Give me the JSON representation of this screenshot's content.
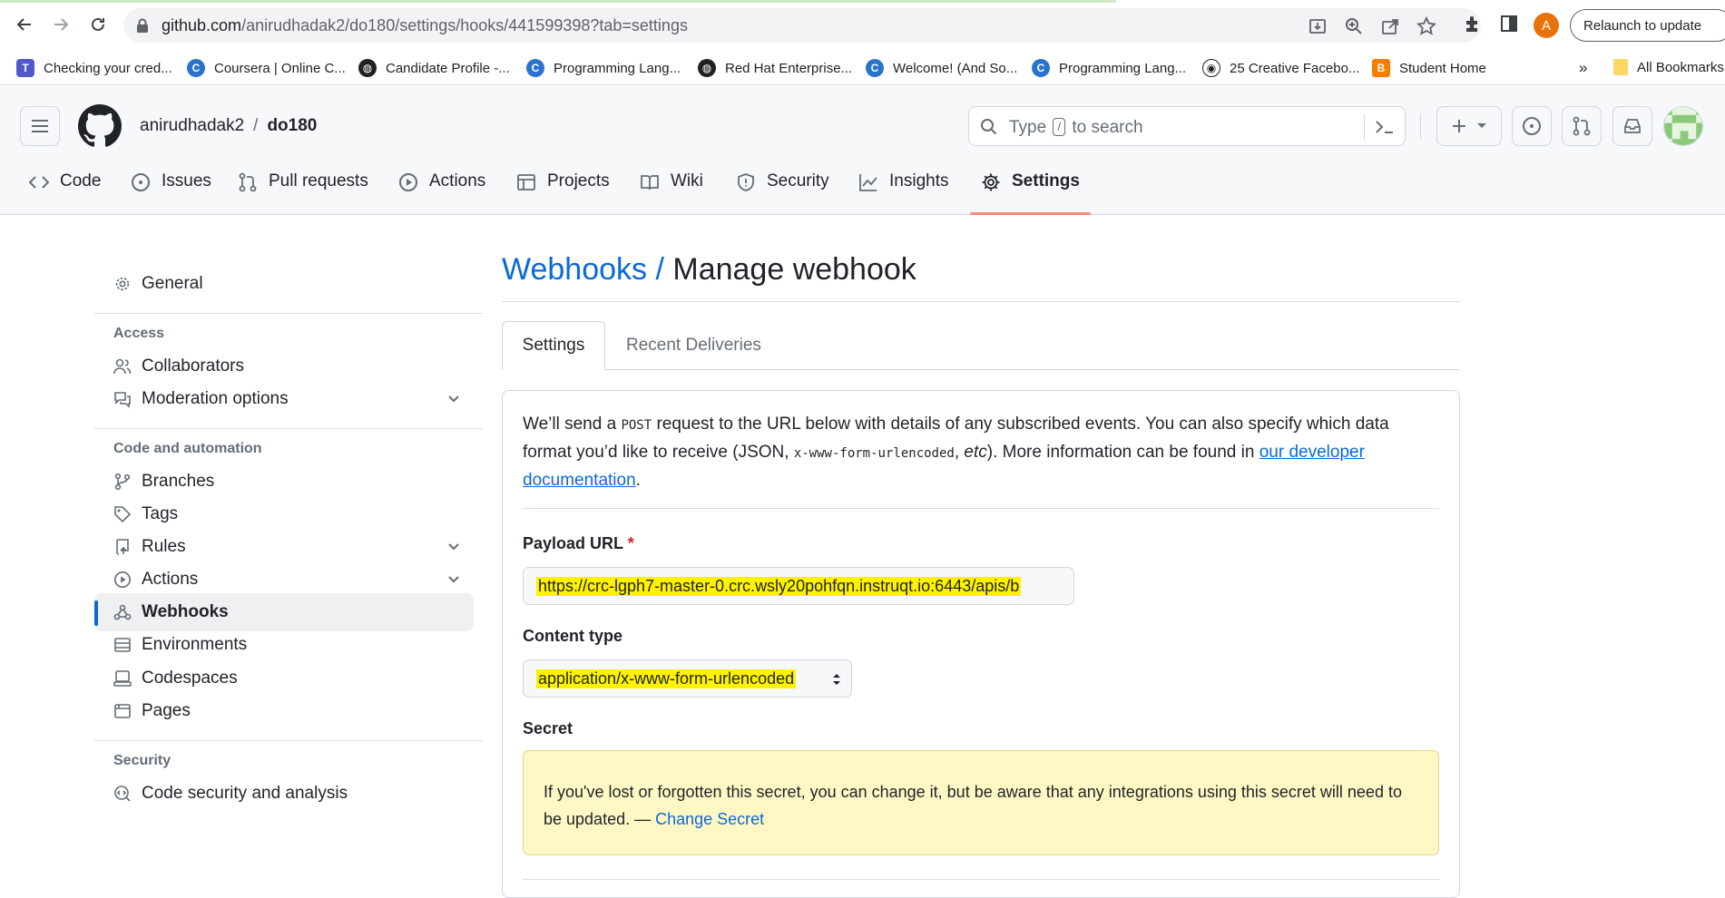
{
  "browser": {
    "url_host": "github.com",
    "url_path": "/anirudhadak2/do180/settings/hooks/441599398?tab=settings",
    "profile_initial": "A",
    "relaunch_label": "Relaunch to update",
    "bookmarks": [
      {
        "label": "Checking your cred...",
        "icon": "teams-icon",
        "color": "#5059c9"
      },
      {
        "label": "Coursera | Online C...",
        "icon": "coursera-icon",
        "color": "#2a73cc"
      },
      {
        "label": "Candidate Profile -...",
        "icon": "globe-icon",
        "color": "#202124"
      },
      {
        "label": "Programming Lang...",
        "icon": "coursera-icon",
        "color": "#2a73cc"
      },
      {
        "label": "Red Hat Enterprise...",
        "icon": "globe-icon",
        "color": "#202124"
      },
      {
        "label": "Welcome! (And So...",
        "icon": "coursera-icon",
        "color": "#2a73cc"
      },
      {
        "label": "Programming Lang...",
        "icon": "coursera-icon",
        "color": "#2a73cc"
      },
      {
        "label": "25 Creative Facebo...",
        "icon": "panda-icon",
        "color": "#202124"
      },
      {
        "label": "Student Home",
        "icon": "blogger-icon",
        "color": "#f57d00"
      }
    ],
    "bookmarks_overflow": "»",
    "all_bookmarks_label": "All Bookmarks"
  },
  "header": {
    "owner": "anirudhadak2",
    "separator": "/",
    "repo": "do180",
    "search_prefix": "Type",
    "search_key": "/",
    "search_suffix": "to search"
  },
  "repo_tabs": [
    {
      "label": "Code",
      "icon": "code-icon"
    },
    {
      "label": "Issues",
      "icon": "issue-opened-icon"
    },
    {
      "label": "Pull requests",
      "icon": "git-pull-request-icon"
    },
    {
      "label": "Actions",
      "icon": "play-icon"
    },
    {
      "label": "Projects",
      "icon": "table-icon"
    },
    {
      "label": "Wiki",
      "icon": "book-icon"
    },
    {
      "label": "Security",
      "icon": "shield-icon"
    },
    {
      "label": "Insights",
      "icon": "graph-icon"
    },
    {
      "label": "Settings",
      "icon": "gear-icon",
      "active": true
    }
  ],
  "sidebar": {
    "general": "General",
    "access_heading": "Access",
    "collaborators": "Collaborators",
    "moderation": "Moderation options",
    "code_heading": "Code and automation",
    "branches": "Branches",
    "tags": "Tags",
    "rules": "Rules",
    "actions": "Actions",
    "webhooks": "Webhooks",
    "environments": "Environments",
    "codespaces": "Codespaces",
    "pages": "Pages",
    "security_heading": "Security",
    "code_security": "Code security and analysis"
  },
  "main": {
    "breadcrumb": "Webhooks /",
    "title": "Manage webhook",
    "tab_settings": "Settings",
    "tab_deliveries": "Recent Deliveries",
    "intro_1": "We’ll send a",
    "intro_post": "POST",
    "intro_2": "request to the URL below with details of any subscribed events. You can also specify which data format you’d like to receive (JSON,",
    "intro_code": "x-www-form-urlencoded",
    "intro_3": ",",
    "intro_etc": "etc",
    "intro_4": "). More information can be found in",
    "intro_link": "our developer documentation",
    "intro_end": ".",
    "payload_label": "Payload URL",
    "required_mark": "*",
    "payload_value": "https://crc-lgph7-master-0.crc.wsly20pohfqn.instruqt.io:6443/apis/b",
    "content_type_label": "Content type",
    "content_type_value": "application/x-www-form-urlencoded",
    "secret_label": "Secret",
    "secret_msg": "If you've lost or forgotten this secret, you can change it, but be aware that any integrations using this secret will need to be updated. —",
    "change_secret": "Change Secret"
  },
  "colors": {
    "link": "#0969da",
    "active_underline": "#fd8c73",
    "highlight": "#fff200",
    "flash_bg": "#fff8c5"
  }
}
